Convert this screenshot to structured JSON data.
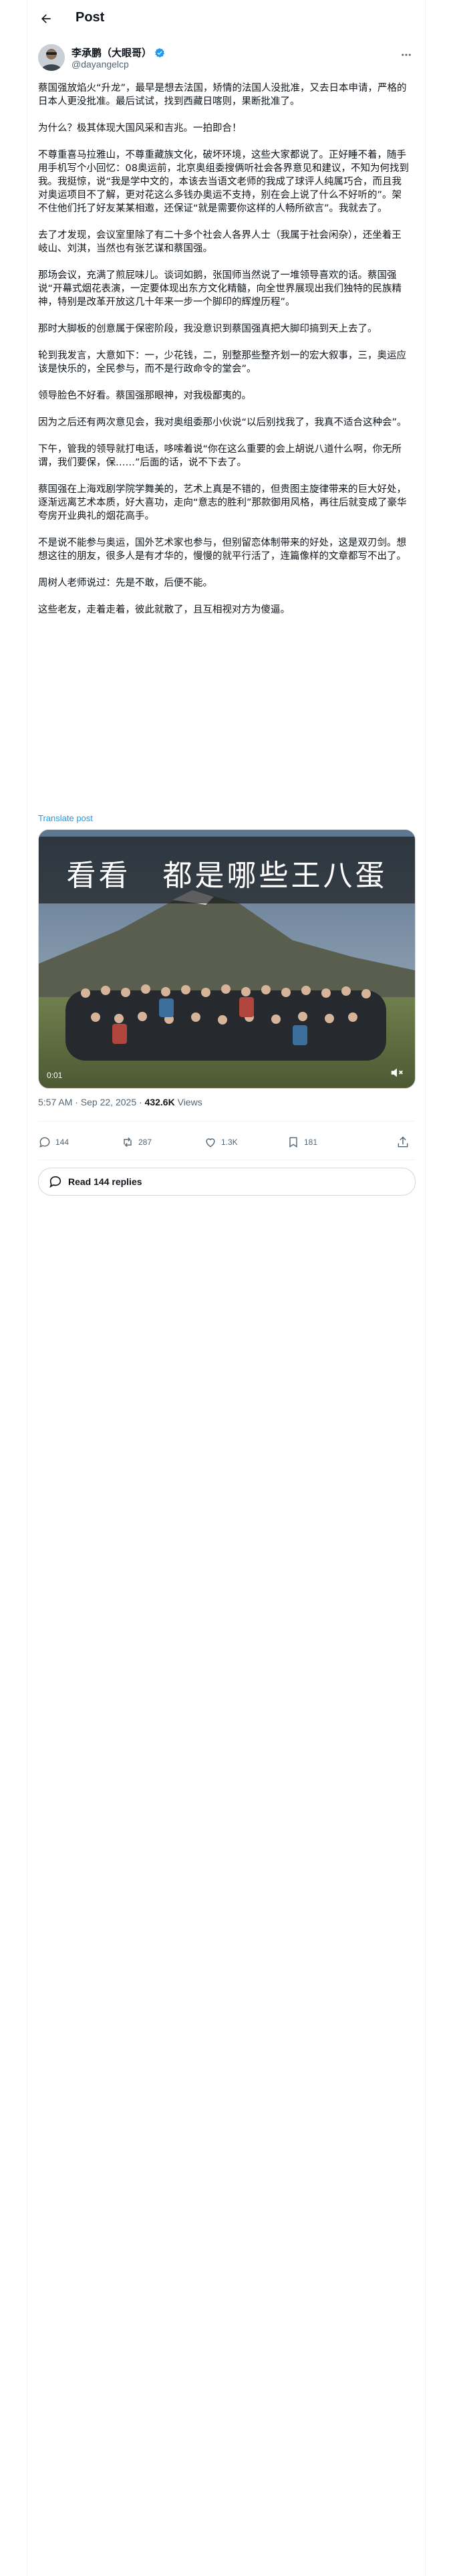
{
  "header": {
    "title": "Post"
  },
  "author": {
    "name": "李承鹏（大眼哥）",
    "handle": "@dayangelcp"
  },
  "paragraphs": [
    "蔡国强放焰火“升龙”，最早是想去法国，矫情的法国人没批准，又去日本申请，严格的日本人更没批准。最后试试，找到西藏日喀则，果断批准了。",
    "为什么？极其体现大国风采和吉兆。一拍即合！",
    "不尊重喜马拉雅山，不尊重藏族文化，破坏环境，这些大家都说了。正好睡不着，随手用手机写个小回忆：08奥运前，北京奥组委搜俩听社会各界意见和建议，不知为何找到我。我挺惊，说“我是学中文的，本该去当语文老师的我成了球评人纯属巧合，而且我对奥运项目不了解，更对花这么多钱办奥运不支持，别在会上说了什么不好听的”。架不住他们托了好友某某相邀，还保证“就是需要你这样的人畅所欲言”。我就去了。",
    "去了才发现，会议室里除了有二十多个社会人各界人士（我属于社会闲杂），还坐着王岐山、刘淇，当然也有张艺谋和蔡国强。",
    "那场会议，充满了煎屁味儿。谈词如鹅，张国师当然说了一堆领导喜欢的话。蔡国强说“开幕式烟花表演，一定要体现出东方文化精髓，向全世界展现出我们独特的民族精神，特别是改革开放这几十年来一步一个脚印的辉煌历程”。",
    "那时大脚板的创意属于保密阶段，我没意识到蔡国强真把大脚印搞到天上去了。",
    "轮到我发言，大意如下：一，少花钱，二，别整那些整齐划一的宏大叙事，三，奥运应该是快乐的，全民参与，而不是行政命令的堂会”。",
    "领导脸色不好看。蔡国强那眼神，对我极鄙夷的。",
    "因为之后还有两次意见会，我对奥组委那小伙说“以后别找我了，我真不适合这种会”。",
    "下午，管我的领导就打电话，哆嗦着说“你在这么重要的会上胡说八道什么啊，你无所谓，我们要保，保……”后面的话，说不下去了。",
    "蔡国强在上海戏剧学院学舞美的，艺术上真是不错的，但贵图主旋律带来的巨大好处，逐渐远离艺术本质，好大喜功，走向“意志的胜利”那款御用风格，再往后就变成了豪华夸房开业典礼的烟花高手。",
    "不是说不能参与奥运，国外艺术家也参与，但别留恋体制带来的好处，这是双刃剑。想想这往的朋友，很多人是有才华的，慢慢的就平行活了，连篇像样的文章都写不出了。",
    "周树人老师说过：先是不敢，后便不能。",
    "这些老友，走着走着，彼此就散了，且互相视对方为傻逼。"
  ],
  "translate_label": "Translate post",
  "video": {
    "caption": "看看　都是哪些王八蛋",
    "time": "0:01"
  },
  "meta": {
    "time": "5:57 AM · Sep 22, 2025",
    "sep": " · ",
    "views_count": "432.6K",
    "views_label": " Views"
  },
  "actions": {
    "replies": "144",
    "reposts": "287",
    "likes": "1.3K",
    "bookmarks": "181"
  },
  "read_replies": "Read 144 replies",
  "colors": {
    "accent": "#1d9bf0",
    "muted": "#536471",
    "text": "#0f1419"
  },
  "icons": [
    "back-arrow-icon",
    "verified-badge-icon",
    "more-icon",
    "reply-icon",
    "repost-icon",
    "like-icon",
    "bookmark-icon",
    "share-icon",
    "speech-bubble-icon",
    "volume-icon"
  ]
}
